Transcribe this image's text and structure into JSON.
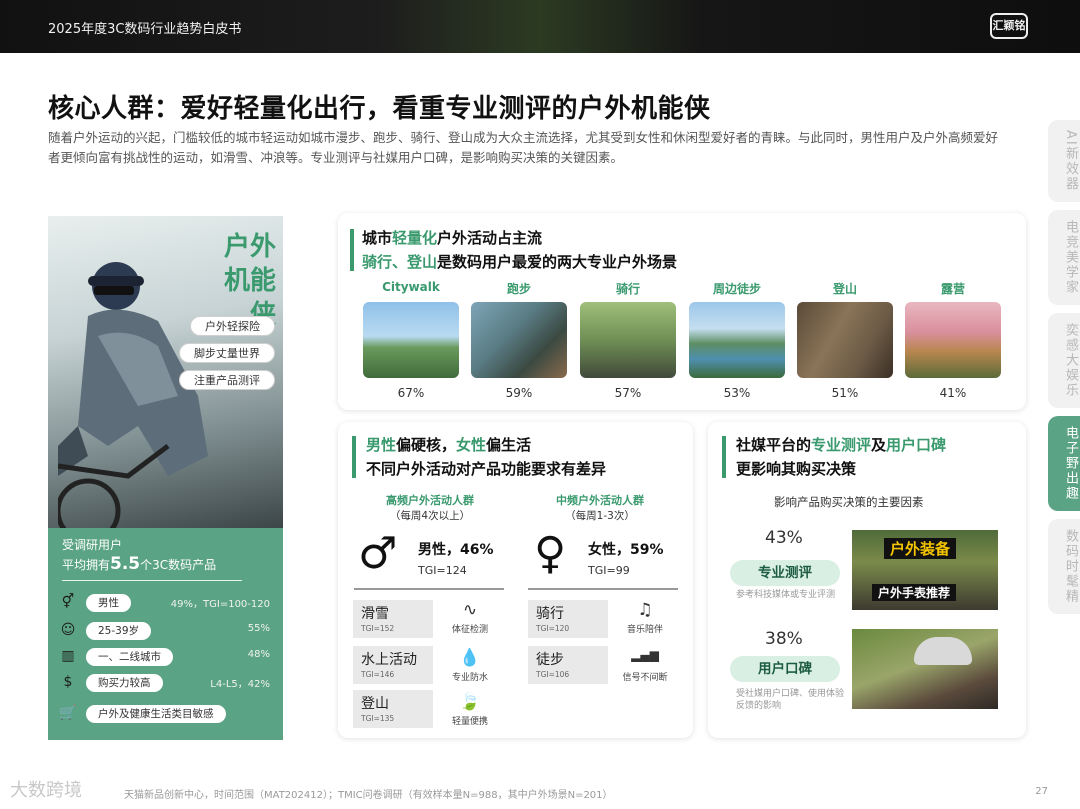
{
  "header": {
    "doc_title": "2025年度3C数码行业趋势白皮书",
    "logo_text": "汇颖铭"
  },
  "headline": "核心人群：爱好轻量化出行，看重专业测评的户外机能侠",
  "intro": "随着户外运动的兴起，门槛较低的城市轻运动如城市漫步、跑步、骑行、登山成为大众主流选择，尤其受到女性和休闲型爱好者的青睐。与此同时，男性用户及户外高频爱好者更倾向富有挑战性的运动，如滑雪、冲浪等。专业测评与社媒用户口碑，是影响购买决策的关键因素。",
  "side_tabs": [
    "AI新效器",
    "电竞美学家",
    "奕感大娱乐",
    "电子野出趣",
    "数码时髦精"
  ],
  "side_tab_active": 3,
  "hero": {
    "title": "户外机能侠",
    "tags": [
      "户外轻探险",
      "脚步丈量世界",
      "注重产品测评"
    ],
    "line1": "受调研用户",
    "line2_prefix": "平均拥有",
    "line2_num": "5.5",
    "line2_suffix": "个3C数码产品",
    "stats": [
      {
        "icon": "gender-icon",
        "glyph": "⚥",
        "label": "男性",
        "value": "49%，TGI=100-120"
      },
      {
        "icon": "person-icon",
        "glyph": "☺",
        "label": "25-39岁",
        "value": "55%"
      },
      {
        "icon": "city-icon",
        "glyph": "▥",
        "label": "一、二线城市",
        "value": "48%"
      },
      {
        "icon": "money-icon",
        "glyph": "$",
        "label": "购买力较高",
        "value": "L4-L5，42%"
      },
      {
        "icon": "cart-icon",
        "glyph": "🛒",
        "label": "户外及健康生活类目敏感",
        "value": ""
      }
    ]
  },
  "top_card": {
    "heading_line1_a": "城市",
    "heading_line1_b": "轻量化",
    "heading_line1_c": "户外活动占主流",
    "heading_line2_a": "骑行、登山",
    "heading_line2_b": "是数码用户最爱的两大专业户外场景",
    "scenes": [
      {
        "name": "Citywalk",
        "pct": "67%"
      },
      {
        "name": "跑步",
        "pct": "59%"
      },
      {
        "name": "骑行",
        "pct": "57%"
      },
      {
        "name": "周边徒步",
        "pct": "53%"
      },
      {
        "name": "登山",
        "pct": "51%"
      },
      {
        "name": "露营",
        "pct": "41%"
      }
    ]
  },
  "mid_card": {
    "heading_a": "男性",
    "heading_b": "偏硬核，",
    "heading_c": "女性",
    "heading_d": "偏生活",
    "heading_line2": "不同户外活动对产品功能要求有差异",
    "left_group": {
      "title": "高频户外活动人群",
      "sub": "（每周4次以上）",
      "symbol": "♂",
      "label": "男性，46%",
      "tgi": "TGI=124",
      "activities": [
        {
          "name": "滑雪",
          "tgi": "TGI=152"
        },
        {
          "name": "水上活动",
          "tgi": "TGI=146"
        },
        {
          "name": "登山",
          "tgi": "TGI=135"
        }
      ],
      "features": [
        {
          "icon": "pulse-icon",
          "glyph": "∿",
          "label": "体征检测"
        },
        {
          "icon": "water-drop-icon",
          "glyph": "💧",
          "label": "专业防水"
        },
        {
          "icon": "leaf-icon",
          "glyph": "🍃",
          "label": "轻量便携"
        }
      ]
    },
    "right_group": {
      "title": "中频户外活动人群",
      "sub": "（每周1-3次）",
      "symbol": "♀",
      "label": "女性，59%",
      "tgi": "TGI=99",
      "activities": [
        {
          "name": "骑行",
          "tgi": "TGI=120"
        },
        {
          "name": "徒步",
          "tgi": "TGI=106"
        }
      ],
      "features": [
        {
          "icon": "music-note-icon",
          "glyph": "♫",
          "label": "音乐陪伴"
        },
        {
          "icon": "signal-icon",
          "glyph": "▂▄▆",
          "label": "信号不间断"
        }
      ]
    }
  },
  "right_card": {
    "heading_a": "社媒平台的",
    "heading_b": "专业测评",
    "heading_c": "及",
    "heading_d": "用户口碑",
    "heading_line2": "更影响其购买决策",
    "subtitle": "影响产品购买决策的主要因素",
    "factors": [
      {
        "pct": "43%",
        "label": "专业测评",
        "note": "参考科技媒体或专业评测",
        "photo_text_1": "户外装备",
        "photo_text_2": "户外手表推荐"
      },
      {
        "pct": "38%",
        "label": "用户口碑",
        "note": "受社媒用户口碑、使用体验反馈的影响"
      }
    ]
  },
  "footer": {
    "source": "天猫新品创新中心，时间范围（MAT202412）；TMIC问卷调研（有效样本量N=988，其中户外场景N=201）",
    "page": "27",
    "watermark": "大数跨境"
  },
  "colors": {
    "accent": "#3a9a6e",
    "hero_green": "#5aa384",
    "pill_bg": "#d9efe3"
  }
}
